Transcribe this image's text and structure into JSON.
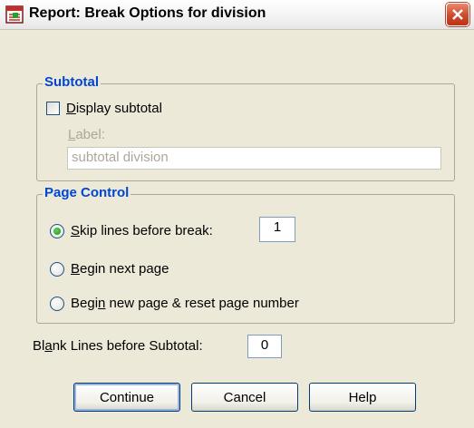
{
  "window": {
    "title": "Report: Break Options for division"
  },
  "subtotal_group": {
    "title": "Subtotal",
    "display_checkbox": {
      "mnemonic": "D",
      "rest": "isplay subtotal",
      "checked": false
    },
    "label_caption": {
      "mnemonic": "L",
      "rest": "abel:"
    },
    "label_value": "subtotal division"
  },
  "page_control_group": {
    "title": "Page Control",
    "options": [
      {
        "pre": "",
        "mnemonic": "S",
        "rest": "kip lines before break:",
        "checked": true
      },
      {
        "pre": "",
        "mnemonic": "B",
        "rest": "egin next page",
        "checked": false
      },
      {
        "pre": "Begi",
        "mnemonic": "n",
        "rest": " new page & reset page number",
        "checked": false
      }
    ],
    "skip_lines_value": "1"
  },
  "blank_lines": {
    "pre": "Bl",
    "mnemonic": "a",
    "rest": "nk Lines before Subtotal:",
    "value": "0"
  },
  "buttons": {
    "continue": "Continue",
    "cancel": "Cancel",
    "help": "Help"
  },
  "icons": {
    "app": "spss-report-icon",
    "close": "close-icon"
  }
}
